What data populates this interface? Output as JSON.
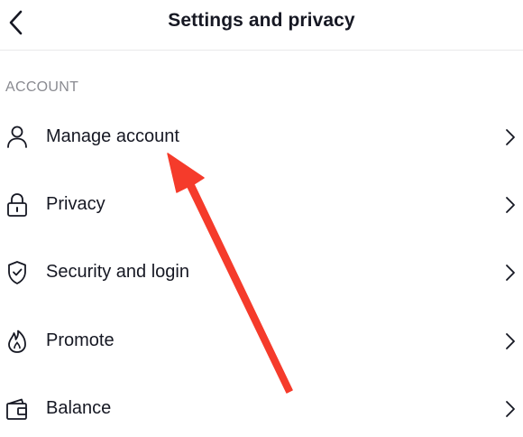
{
  "header": {
    "title": "Settings and privacy",
    "back_icon": "chevron-left-icon"
  },
  "account_section": {
    "label": "ACCOUNT",
    "items": [
      {
        "label": "Manage account",
        "icon": "person-icon"
      },
      {
        "label": "Privacy",
        "icon": "lock-icon"
      },
      {
        "label": "Security and login",
        "icon": "shield-icon"
      },
      {
        "label": "Promote",
        "icon": "flame-icon"
      },
      {
        "label": "Balance",
        "icon": "wallet-icon"
      }
    ]
  },
  "colors": {
    "text": "#161823",
    "secondary_text": "#8a8b91",
    "divider": "#e9e9ea",
    "annotation_arrow": "#f53b2b"
  }
}
